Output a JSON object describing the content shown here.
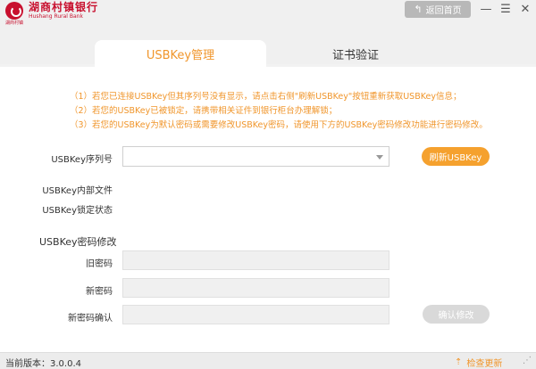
{
  "header": {
    "bank_name_cn": "湖商村镇银行",
    "bank_name_en": "Hushang Rural Bank",
    "logo_sub": "湖商村镇",
    "home_label": "返回首页",
    "home_icon": "back-arrow-icon",
    "min_glyph": "—",
    "menu_glyph": "☰",
    "close_glyph": "✕"
  },
  "tabs": [
    {
      "label": "USBKey管理",
      "active": true
    },
    {
      "label": "证书验证",
      "active": false
    }
  ],
  "notice": [
    "（1）若您已连接USBKey但其序列号没有显示，请点击右侧\"刷新USBKey\"按钮重新获取USBKey信息；",
    "（2）若您的USBKey已被锁定，请携带相关证件到银行柜台办理解锁；",
    "（3）若您的USBKey为默认密码或需要修改USBKey密码，请使用下方的USBKey密码修改功能进行密码修改。"
  ],
  "form": {
    "serial_label": "USBKey序列号",
    "serial_value": "",
    "refresh_label": "刷新USBKey",
    "internal_file_label": "USBKey内部文件",
    "lock_status_label": "USBKey锁定状态"
  },
  "password": {
    "section_title": "USBKey密码修改",
    "old_label": "旧密码",
    "new_label": "新密码",
    "confirm_label": "新密码确认",
    "confirm_button": "确认修改"
  },
  "footer": {
    "version": "当前版本：3.0.0.4",
    "update_label": "检查更新",
    "grip": "⋰"
  },
  "colors": {
    "accent": "#f0962c",
    "brand": "#c8102e"
  }
}
